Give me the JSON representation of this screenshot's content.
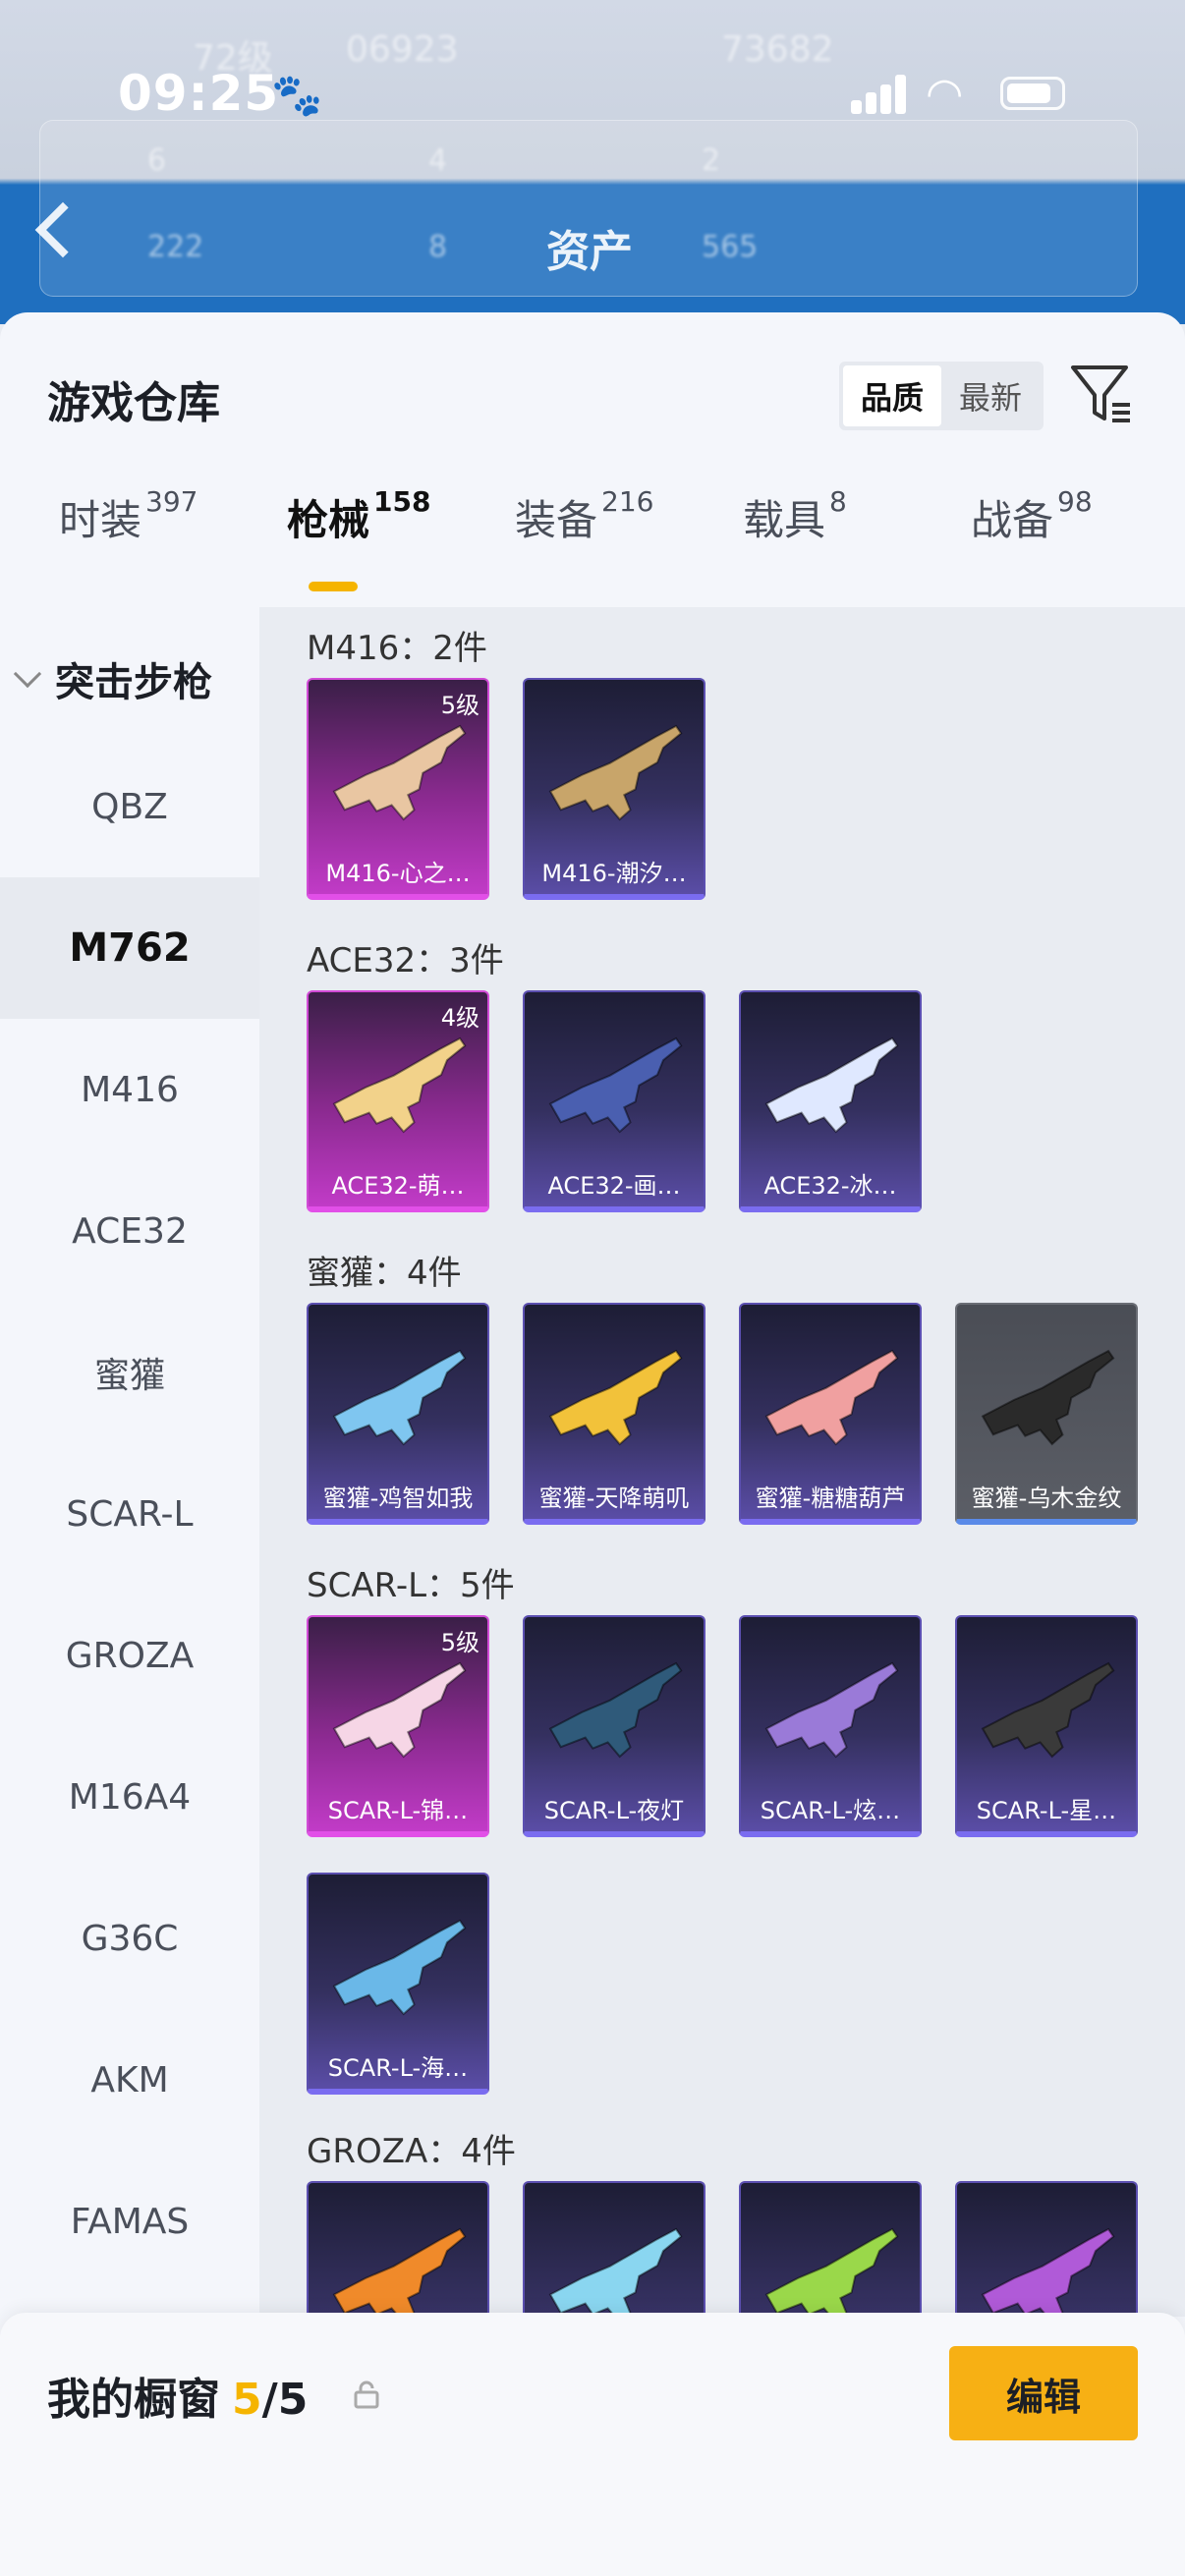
{
  "status": {
    "time": "09:25",
    "paw": "🐾"
  },
  "background": {
    "title": "资产",
    "blur_texts": [
      "72级",
      "06923",
      "73682",
      "6",
      "4",
      "2",
      "222",
      "8",
      "565"
    ]
  },
  "sheet": {
    "title": "游戏仓库",
    "sort": {
      "quality": "品质",
      "newest": "最新"
    }
  },
  "tabs": [
    {
      "label": "时装",
      "count": "397"
    },
    {
      "label": "枪械",
      "count": "158"
    },
    {
      "label": "装备",
      "count": "216"
    },
    {
      "label": "载具",
      "count": "8"
    },
    {
      "label": "战备",
      "count": "98"
    }
  ],
  "sidebar": {
    "header": "突击步枪",
    "items": [
      "QBZ",
      "M762",
      "M416",
      "ACE32",
      "蜜獾",
      "SCAR-L",
      "GROZA",
      "M16A4",
      "G36C",
      "AKM",
      "FAMAS"
    ]
  },
  "groups": [
    {
      "title": "M416：2件",
      "cards": [
        {
          "name": "M416-心之…",
          "level": "5级",
          "rarity": "gold",
          "color": "#e9c6a2"
        },
        {
          "name": "M416-潮汐…",
          "level": "",
          "rarity": "purple",
          "color": "#c8a56a"
        }
      ]
    },
    {
      "title": "ACE32：3件",
      "cards": [
        {
          "name": "ACE32-萌…",
          "level": "4级",
          "rarity": "gold",
          "color": "#f2d28a"
        },
        {
          "name": "ACE32-画…",
          "level": "",
          "rarity": "purple",
          "color": "#4a5fb0"
        },
        {
          "name": "ACE32-冰…",
          "level": "",
          "rarity": "purple",
          "color": "#dfe8ff"
        }
      ]
    },
    {
      "title": "蜜獾：4件",
      "cards": [
        {
          "name": "蜜獾-鸡智如我",
          "level": "",
          "rarity": "purple",
          "color": "#7fc6f0"
        },
        {
          "name": "蜜獾-天降萌叽",
          "level": "",
          "rarity": "purple",
          "color": "#f2c23a"
        },
        {
          "name": "蜜獾-糖糖葫芦",
          "level": "",
          "rarity": "purple",
          "color": "#f0a0a0"
        },
        {
          "name": "蜜獾-乌木金纹",
          "level": "",
          "rarity": "grey",
          "color": "#2a2a2a"
        }
      ]
    },
    {
      "title": "SCAR-L：5件",
      "cards": [
        {
          "name": "SCAR-L-锦…",
          "level": "5级",
          "rarity": "gold",
          "color": "#f6d6e6"
        },
        {
          "name": "SCAR-L-夜灯",
          "level": "",
          "rarity": "purple",
          "color": "#2f5a7a"
        },
        {
          "name": "SCAR-L-炫…",
          "level": "",
          "rarity": "purple",
          "color": "#9a7ad8"
        },
        {
          "name": "SCAR-L-星…",
          "level": "",
          "rarity": "purple",
          "color": "#3a3a3a"
        },
        {
          "name": "SCAR-L-海…",
          "level": "",
          "rarity": "purple",
          "color": "#6ab8e8"
        }
      ]
    },
    {
      "title": "GROZA：4件",
      "cards": [
        {
          "name": "",
          "level": "",
          "rarity": "purple",
          "color": "#f08a2a"
        },
        {
          "name": "",
          "level": "",
          "rarity": "purple",
          "color": "#8ad6f0"
        },
        {
          "name": "",
          "level": "",
          "rarity": "purple",
          "color": "#9ad84a"
        },
        {
          "name": "",
          "level": "",
          "rarity": "purple",
          "color": "#b05ad8"
        }
      ]
    }
  ],
  "showcase": {
    "title": "我的橱窗",
    "current": "5",
    "separator": "/",
    "total": "5",
    "edit_label": "编辑"
  },
  "icons": [
    "back-arrow-icon",
    "filter-icon",
    "lock-icon",
    "share-icon",
    "chevron-down-icon"
  ]
}
